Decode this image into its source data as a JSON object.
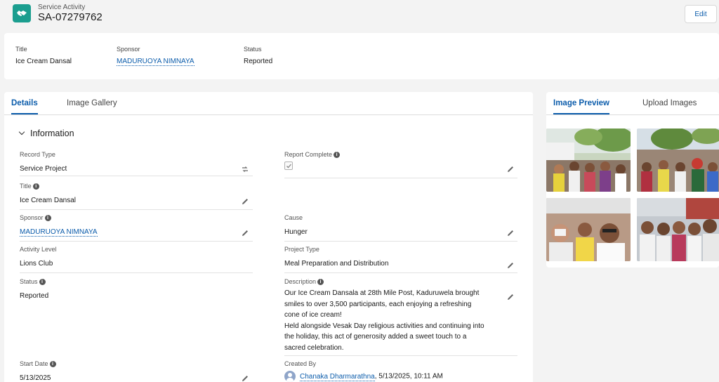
{
  "header": {
    "object_label": "Service Activity",
    "record_name": "SA-07279762",
    "edit_label": "Edit"
  },
  "highlights": {
    "title_label": "Title",
    "title_value": "Ice Cream Dansal",
    "sponsor_label": "Sponsor",
    "sponsor_value": "MADURUOYA NIMNAYA",
    "status_label": "Status",
    "status_value": "Reported"
  },
  "tabs": {
    "details": "Details",
    "image_gallery": "Image Gallery"
  },
  "section": {
    "title": "Information"
  },
  "fields": {
    "record_type": {
      "label": "Record Type",
      "value": "Service Project"
    },
    "report_complete": {
      "label": "Report Complete",
      "checked": true
    },
    "title": {
      "label": "Title",
      "value": "Ice Cream Dansal"
    },
    "sponsor": {
      "label": "Sponsor",
      "value": "MADURUOYA NIMNAYA"
    },
    "cause": {
      "label": "Cause",
      "value": "Hunger"
    },
    "activity_level": {
      "label": "Activity Level",
      "value": "Lions Club"
    },
    "project_type": {
      "label": "Project Type",
      "value": "Meal Preparation and Distribution"
    },
    "status": {
      "label": "Status",
      "value": "Reported"
    },
    "description": {
      "label": "Description",
      "line1": "Our Ice Cream Dansala at 28th Mile Post, Kaduruwela brought",
      "line2": "smiles to over 3,500 participants, each enjoying a refreshing",
      "line3": "cone of ice cream!",
      "line4": "Held alongside Vesak Day religious activities and continuing into",
      "line5": "the holiday, this act of generosity added a sweet touch to a",
      "line6": "sacred celebration."
    },
    "start_date": {
      "label": "Start Date",
      "value": "5/13/2025"
    },
    "created_by": {
      "label": "Created By",
      "user": "Chanaka Dharmarathna",
      "timestamp": ", 5/13/2025, 10:11 AM"
    }
  },
  "image_panel": {
    "tab_preview": "Image Preview",
    "tab_upload": "Upload Images"
  },
  "colors": {
    "brand_icon": "#1b9e8f",
    "link": "#0b5cab"
  }
}
